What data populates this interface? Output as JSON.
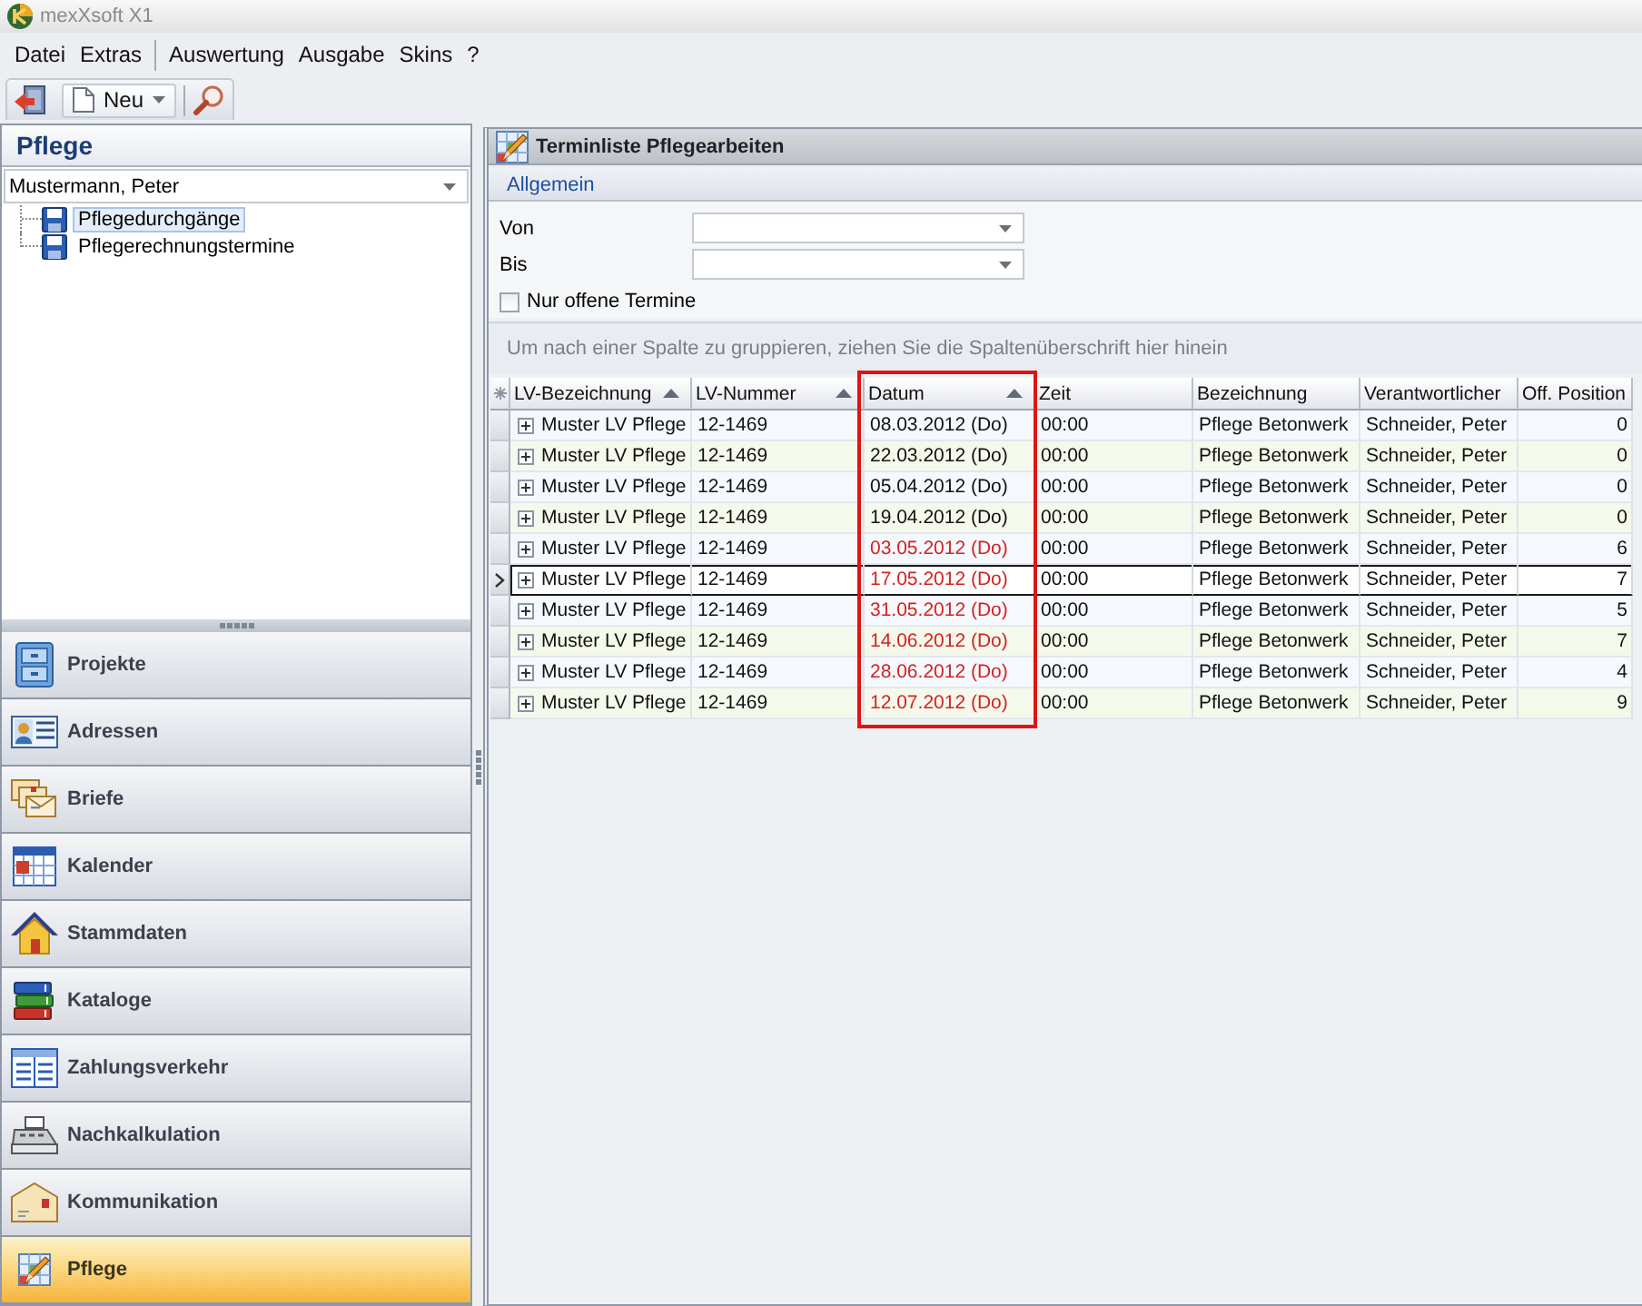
{
  "window": {
    "title": "mexXsoft X1"
  },
  "menu": [
    {
      "items": [
        "Datei",
        "Extras"
      ]
    },
    {
      "items": [
        "Auswertung",
        "Ausgabe",
        "Skins",
        "?"
      ]
    }
  ],
  "toolbar": {
    "new_button": {
      "label": "Neu"
    }
  },
  "sidebar": {
    "title": "Pflege",
    "person_select": {
      "value": "Mustermann, Peter"
    },
    "tree": [
      {
        "label": "Pflegedurchgänge",
        "selected": true
      },
      {
        "label": "Pflegerechnungstermine",
        "selected": false
      }
    ],
    "nav": [
      {
        "label": "Projekte",
        "selected": false
      },
      {
        "label": "Adressen",
        "selected": false
      },
      {
        "label": "Briefe",
        "selected": false
      },
      {
        "label": "Kalender",
        "selected": false
      },
      {
        "label": "Stammdaten",
        "selected": false
      },
      {
        "label": "Kataloge",
        "selected": false
      },
      {
        "label": "Zahlungsverkehr",
        "selected": false
      },
      {
        "label": "Nachkalkulation",
        "selected": false
      },
      {
        "label": "Kommunikation",
        "selected": false
      },
      {
        "label": "Pflege",
        "selected": true
      }
    ]
  },
  "panel": {
    "title": "Terminliste Pflegearbeiten",
    "tabs": [
      {
        "label": "Allgemein",
        "selected": true
      }
    ],
    "filters": [
      {
        "label": "Von"
      },
      {
        "label": "Bis"
      }
    ],
    "open_only": {
      "label": "Nur offene Termine",
      "checked": false
    },
    "group_hint": "Um nach einer Spalte zu gruppieren, ziehen Sie die Spaltenüberschrift hier hinein",
    "table": {
      "columns": [
        {
          "label": "LV-Bezeichnung",
          "sorted": true,
          "highlighted": false,
          "kind": "text"
        },
        {
          "label": "LV-Nummer",
          "sorted": true,
          "highlighted": false,
          "kind": "text"
        },
        {
          "label": "Datum",
          "sorted": true,
          "highlighted": true,
          "kind": "text"
        },
        {
          "label": "Zeit",
          "sorted": false,
          "highlighted": false,
          "kind": "text"
        },
        {
          "label": "Bezeichnung",
          "sorted": false,
          "highlighted": false,
          "kind": "text"
        },
        {
          "label": "Verantwortlicher",
          "sorted": false,
          "highlighted": false,
          "kind": "text"
        },
        {
          "label": "Off. Position",
          "sorted": false,
          "highlighted": false,
          "kind": "number"
        }
      ],
      "rows": [
        {
          "cells": [
            "Muster LV Pflege",
            "12-1469",
            "08.03.2012 (Do)",
            "00:00",
            "Pflege Betonwerk",
            "Schneider, Peter",
            "0"
          ],
          "overdue": false,
          "selected": false,
          "expanded": false
        },
        {
          "cells": [
            "Muster LV Pflege",
            "12-1469",
            "22.03.2012 (Do)",
            "00:00",
            "Pflege Betonwerk",
            "Schneider, Peter",
            "0"
          ],
          "overdue": false,
          "selected": false,
          "expanded": false
        },
        {
          "cells": [
            "Muster LV Pflege",
            "12-1469",
            "05.04.2012 (Do)",
            "00:00",
            "Pflege Betonwerk",
            "Schneider, Peter",
            "0"
          ],
          "overdue": false,
          "selected": false,
          "expanded": false
        },
        {
          "cells": [
            "Muster LV Pflege",
            "12-1469",
            "19.04.2012 (Do)",
            "00:00",
            "Pflege Betonwerk",
            "Schneider, Peter",
            "0"
          ],
          "overdue": false,
          "selected": false,
          "expanded": false
        },
        {
          "cells": [
            "Muster LV Pflege",
            "12-1469",
            "03.05.2012 (Do)",
            "00:00",
            "Pflege Betonwerk",
            "Schneider, Peter",
            "6"
          ],
          "overdue": true,
          "selected": false,
          "expanded": false
        },
        {
          "cells": [
            "Muster LV Pflege",
            "12-1469",
            "17.05.2012 (Do)",
            "00:00",
            "Pflege Betonwerk",
            "Schneider, Peter",
            "7"
          ],
          "overdue": true,
          "selected": true,
          "expanded": false
        },
        {
          "cells": [
            "Muster LV Pflege",
            "12-1469",
            "31.05.2012 (Do)",
            "00:00",
            "Pflege Betonwerk",
            "Schneider, Peter",
            "5"
          ],
          "overdue": true,
          "selected": false,
          "expanded": false
        },
        {
          "cells": [
            "Muster LV Pflege",
            "12-1469",
            "14.06.2012 (Do)",
            "00:00",
            "Pflege Betonwerk",
            "Schneider, Peter",
            "7"
          ],
          "overdue": true,
          "selected": false,
          "expanded": false
        },
        {
          "cells": [
            "Muster LV Pflege",
            "12-1469",
            "28.06.2012 (Do)",
            "00:00",
            "Pflege Betonwerk",
            "Schneider, Peter",
            "4"
          ],
          "overdue": true,
          "selected": false,
          "expanded": false
        },
        {
          "cells": [
            "Muster LV Pflege",
            "12-1469",
            "12.07.2012 (Do)",
            "00:00",
            "Pflege Betonwerk",
            "Schneider, Peter",
            "9"
          ],
          "overdue": true,
          "selected": false,
          "expanded": false
        }
      ]
    }
  }
}
